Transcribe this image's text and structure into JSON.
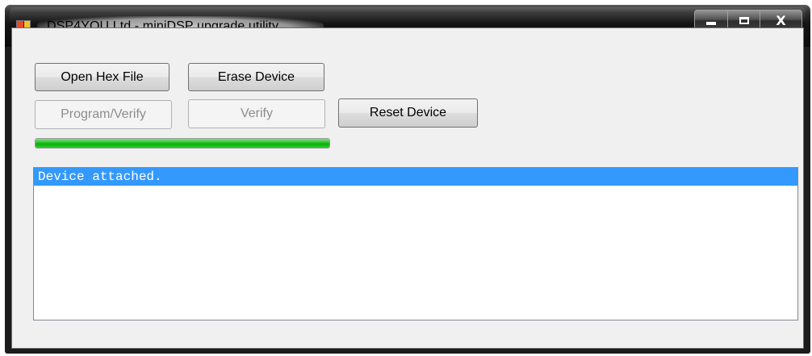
{
  "window": {
    "title": "DSP4YOU Ltd - miniDSP upgrade utility",
    "icon": "app-icon",
    "controls": {
      "minimize": "minimize-icon",
      "maximize": "maximize-icon",
      "close_label": "X"
    }
  },
  "buttons": {
    "open_hex": "Open Hex File",
    "erase": "Erase Device",
    "program_verify": "Program/Verify",
    "verify": "Verify",
    "reset": "Reset Device"
  },
  "progress": {
    "fraction": 1.0,
    "color": "#06b006"
  },
  "log": {
    "lines": [
      "Device attached."
    ],
    "selected_index": 0,
    "selection_color": "#3399ff"
  }
}
